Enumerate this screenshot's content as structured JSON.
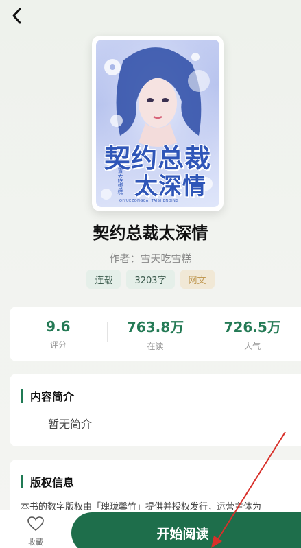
{
  "book": {
    "title": "契约总裁太深情",
    "author_line": "作者：雪天吃雪糕",
    "cover": {
      "title_line_1": "契约总裁",
      "title_line_2": "太深情",
      "author_stamp": "雪天吃雪糕",
      "small_text": "QIYUEZONGCAI TAISHENQING"
    },
    "tags": [
      {
        "label": "连载"
      },
      {
        "label": "3203字"
      },
      {
        "label": "网文"
      }
    ]
  },
  "stats": [
    {
      "value": "9.6",
      "label": "评分"
    },
    {
      "value": "763.8万",
      "label": "在读"
    },
    {
      "value": "726.5万",
      "label": "人气"
    }
  ],
  "intro": {
    "title": "内容简介",
    "text": "暂无简介"
  },
  "copyright": {
    "title": "版权信息",
    "text": "本书的数字版权由「瑰珑馨竹」提供并授权发行，运营主体为"
  },
  "bottom_bar": {
    "favorite_label": "收藏",
    "read_button": "开始阅读"
  },
  "colors": {
    "accent_green": "#1e6e4b",
    "stat_green": "#247a55",
    "annotation_red": "#d8302a"
  }
}
